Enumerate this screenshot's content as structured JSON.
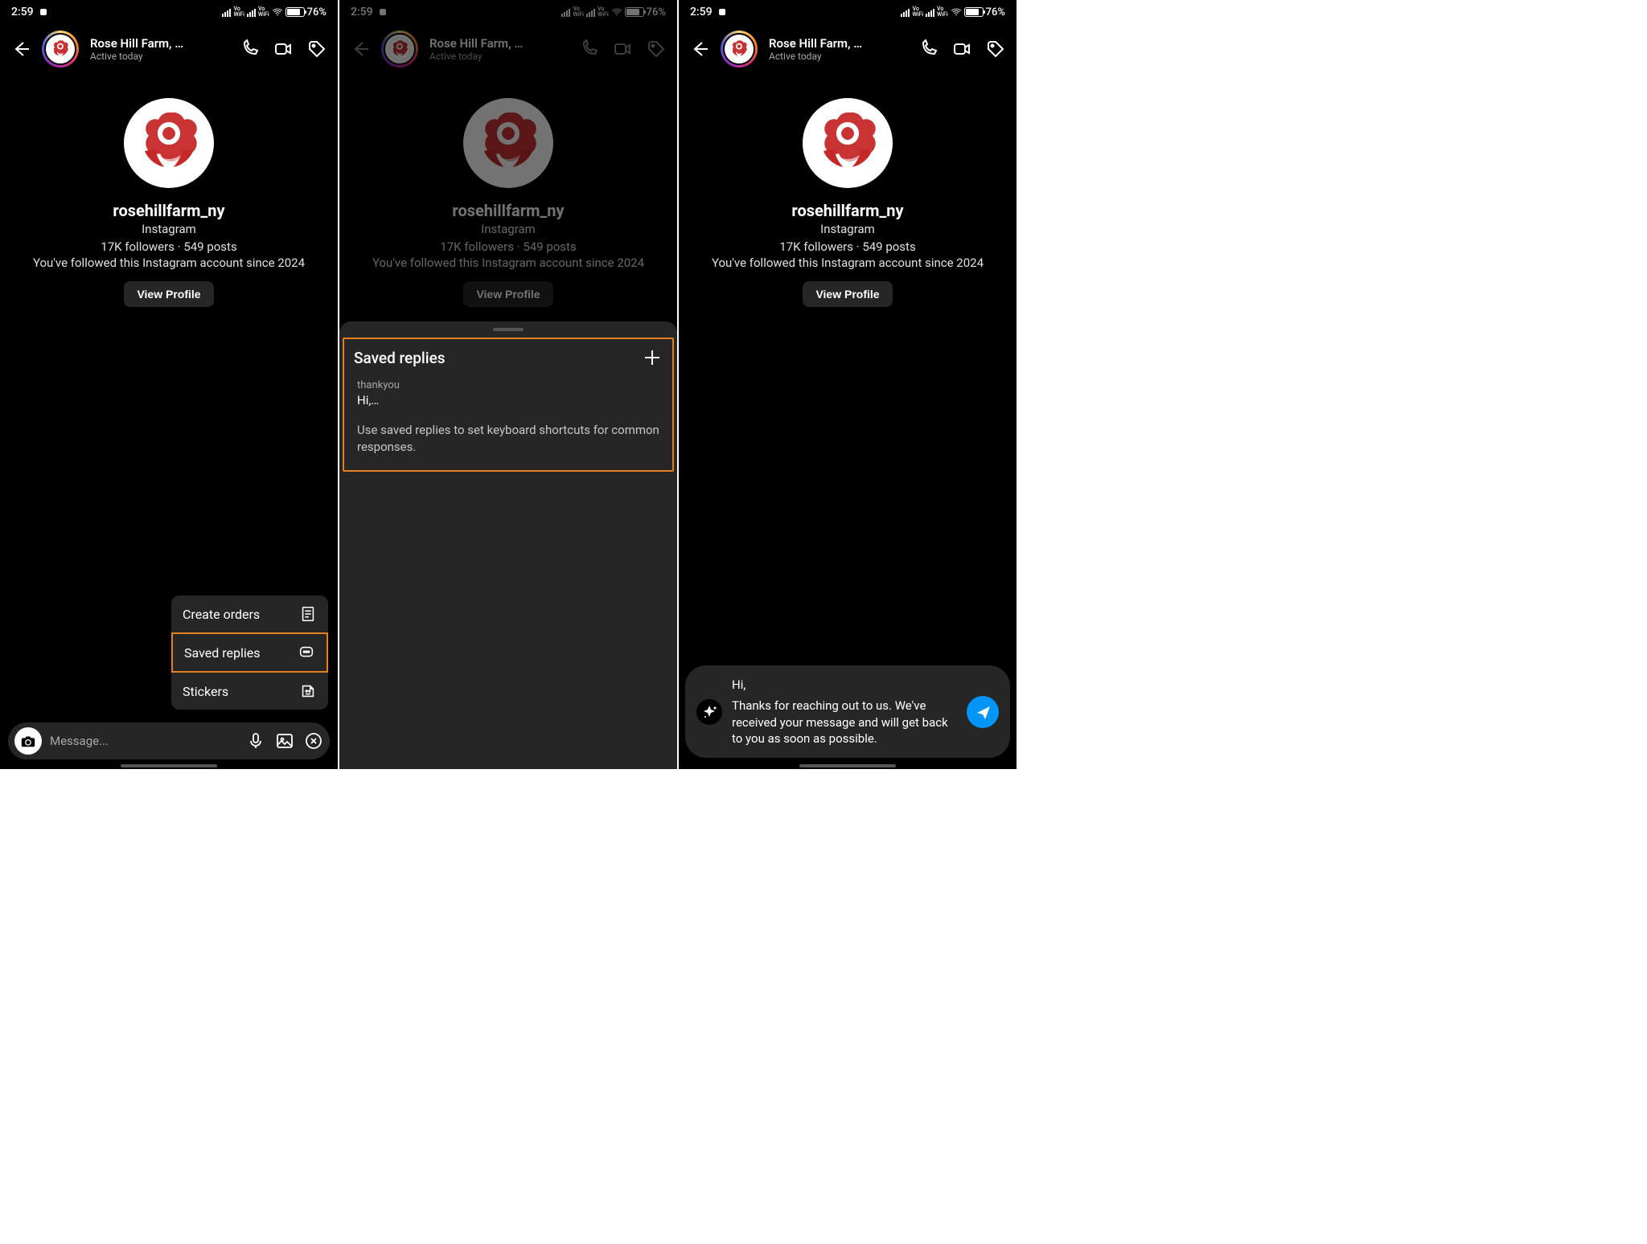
{
  "status": {
    "time": "2:59",
    "battery_pct": "76%"
  },
  "chat": {
    "title": "Rose Hill Farm, …",
    "subtitle": "Active today"
  },
  "profile": {
    "username": "rosehillfarm_ny",
    "platform": "Instagram",
    "stats": "17K followers · 549 posts",
    "followed_since": "You've followed this Instagram account since 2024",
    "view_profile_label": "View Profile"
  },
  "popup": {
    "create_orders": "Create orders",
    "saved_replies": "Saved replies",
    "stickers": "Stickers"
  },
  "message_bar": {
    "placeholder": "Message..."
  },
  "sheet": {
    "title": "Saved replies",
    "reply_shortcut": "thankyou",
    "reply_preview": "Hi,…",
    "hint": "Use saved replies to set keyboard shortcuts for common responses."
  },
  "compose": {
    "line1": "Hi,",
    "body": "Thanks for reaching out to us. We've received your message and will get back to you as soon as possible."
  }
}
